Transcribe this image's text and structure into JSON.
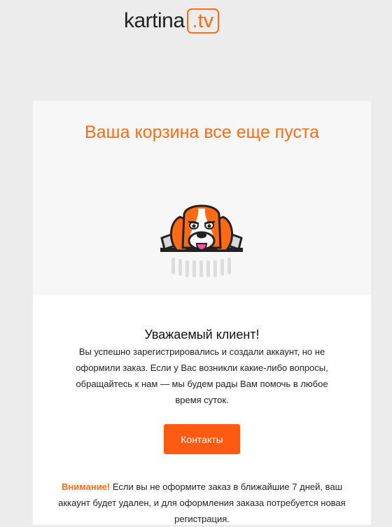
{
  "brand": {
    "name": "kartina",
    "suffix": ".tv",
    "accent": "#ff6a13"
  },
  "hero": {
    "title": "Ваша корзина все еще пуста"
  },
  "message": {
    "greeting": "Уважаемый клиент!",
    "body": "Вы успешно зарегистрировались и создали аккаунт, но не оформили заказ. Если у Вас возникли какие-либо вопросы, обращайтесь к нам — мы будем рады Вам помочь в любое время суток."
  },
  "cta": {
    "label": "Контакты"
  },
  "warning": {
    "label": "Внимание!",
    "text": " Если вы не оформите заказ в ближайшие 7 дней, ваш аккаунт будет удален, и для оформления заказа потребуется новая регистрация."
  }
}
